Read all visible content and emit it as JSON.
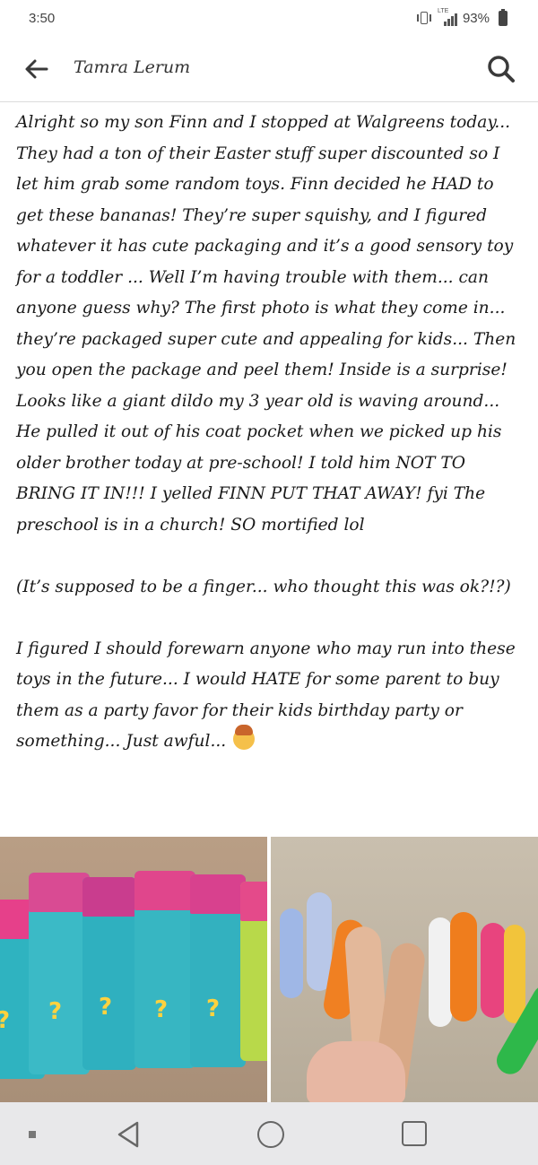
{
  "status_bar": {
    "time": "3:50",
    "network": "LTE",
    "battery": "93%",
    "icons": [
      "vibrate-icon",
      "signal-icon",
      "battery-icon"
    ]
  },
  "app_bar": {
    "title": "Tamra Lerum",
    "back_icon": "arrow-left-icon",
    "search_icon": "search-icon"
  },
  "post": {
    "paragraphs": [
      "Alright so my son Finn and I stopped at Walgreens today... They had a ton of their Easter stuff super discounted so I let him grab some random toys. Finn decided he HAD to get these bananas! They’re super squishy, and I figured whatever it has cute packaging and it’s a good sensory toy for a toddler ... Well I’m having trouble with them... can anyone guess why? The first photo is what they come in... they’re packaged super cute and appealing for kids... Then you open the package and peel them! Inside is a surprise! Looks like a giant dildo my 3 year old is waving around... He pulled it out of his coat pocket when we picked up his older brother today at pre-school! I told him NOT TO BRING IT IN!!! I yelled FINN PUT THAT AWAY!  fyi The preschool is in a church! SO mortified lol",
      "(It’s supposed to be a finger... who thought this was ok?!?)",
      "I figured I should forewarn anyone who may run into these toys in the future... I would HATE  for some parent to buy them as a party favor for their kids birthday party or something... Just awful..."
    ],
    "emoji": "facepalm-emoji",
    "photos": [
      "packaged-banana-toys-photo",
      "unpeeled-toys-photo"
    ]
  },
  "nav_bar": {
    "icons": [
      "menu-dot-icon",
      "back-triangle-icon",
      "home-circle-icon",
      "recents-square-icon"
    ]
  },
  "colors": {
    "text": "#1a1a1a",
    "divider": "#dcdcdc",
    "nav_background": "#e8e8ea"
  }
}
